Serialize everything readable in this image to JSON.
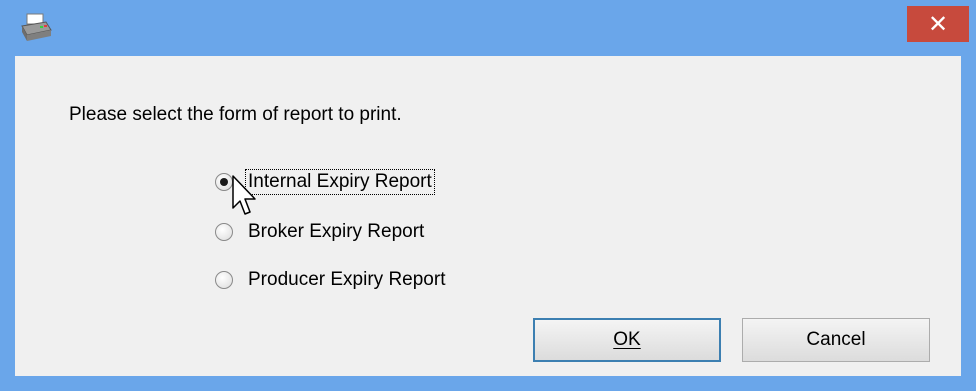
{
  "window": {
    "app_icon": "printer-icon",
    "close_glyph": "✕",
    "colors": {
      "frame": "#6aa6ea",
      "close_button": "#c74a3d",
      "client": "#f0f0f0"
    }
  },
  "dialog": {
    "prompt": "Please select the form of report to print.",
    "options": [
      {
        "label": "Internal Expiry Report",
        "selected": true
      },
      {
        "label": "Broker Expiry Report",
        "selected": false
      },
      {
        "label": "Producer Expiry Report",
        "selected": false
      }
    ],
    "ok_label": "OK",
    "cancel_label": "Cancel"
  }
}
